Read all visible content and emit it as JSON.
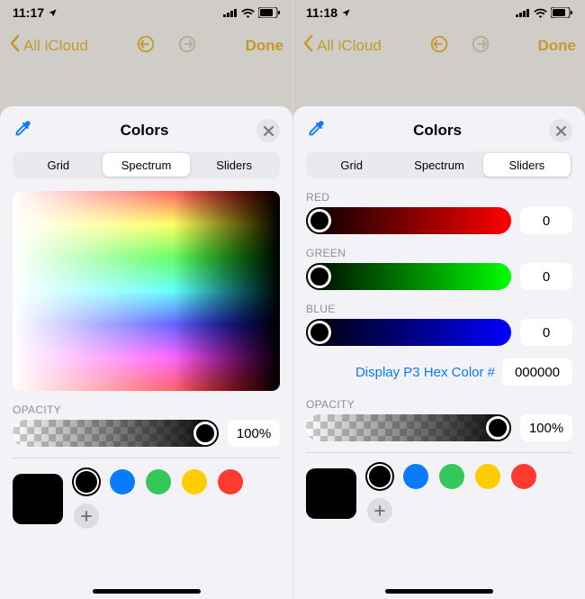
{
  "statusLeft": {
    "time": "11:17",
    "loc": true
  },
  "statusRight": {
    "time": "11:18",
    "loc": true
  },
  "nav": {
    "back": "All iCloud",
    "done": "Done"
  },
  "sheet": {
    "title": "Colors",
    "tabs": {
      "grid": "Grid",
      "spectrum": "Spectrum",
      "sliders": "Sliders"
    }
  },
  "sliders": {
    "red": {
      "label": "RED",
      "value": "0"
    },
    "green": {
      "label": "GREEN",
      "value": "0"
    },
    "blue": {
      "label": "BLUE",
      "value": "0"
    },
    "hexLabel": "Display P3 Hex Color #",
    "hexValue": "000000"
  },
  "opacity": {
    "label": "OPACITY",
    "value": "100%"
  },
  "swatches": {
    "colors": [
      "#000000",
      "#0a7aff",
      "#34c759",
      "#ffcc00",
      "#ff3b30"
    ],
    "selectedIndex": 0
  }
}
